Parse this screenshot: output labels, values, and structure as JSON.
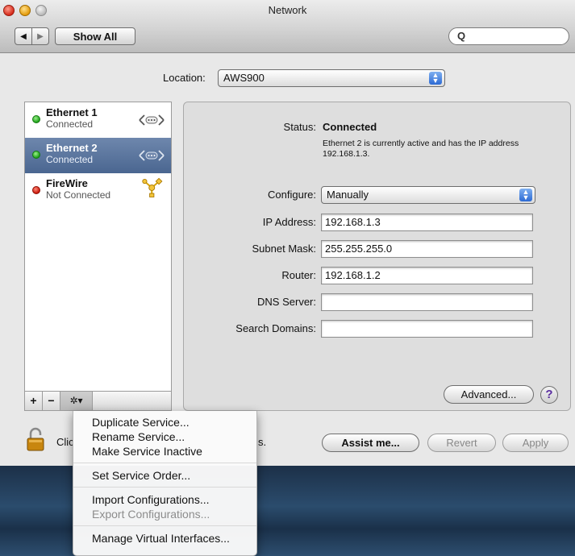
{
  "window": {
    "title": "Network",
    "show_all_label": "Show All",
    "back_glyph": "◀",
    "forward_glyph": "▶",
    "search_placeholder": "",
    "search_glyph": "Q"
  },
  "location": {
    "label": "Location:",
    "value": "AWS900"
  },
  "services": [
    {
      "name": "Ethernet 1",
      "status": "Connected",
      "status_color": "green",
      "icon": "ethernet-icon",
      "selected": false
    },
    {
      "name": "Ethernet 2",
      "status": "Connected",
      "status_color": "green",
      "icon": "ethernet-icon",
      "selected": true
    },
    {
      "name": "FireWire",
      "status": "Not Connected",
      "status_color": "red",
      "icon": "firewire-icon",
      "selected": false
    }
  ],
  "list_toolbar": {
    "add": "+",
    "remove": "−",
    "gear": "✲▾"
  },
  "detail": {
    "status_label": "Status:",
    "status_value": "Connected",
    "status_description": "Ethernet 2 is currently active and has the IP address 192.168.1.3.",
    "configure_label": "Configure:",
    "configure_value": "Manually",
    "ip_label": "IP Address:",
    "ip_value": "192.168.1.3",
    "subnet_label": "Subnet Mask:",
    "subnet_value": "255.255.255.0",
    "router_label": "Router:",
    "router_value": "192.168.1.2",
    "dns_label": "DNS Server:",
    "dns_value": "",
    "search_domains_label": "Search Domains:",
    "search_domains_value": "",
    "advanced_label": "Advanced...",
    "help_glyph": "?"
  },
  "footer": {
    "lock_text": "Clic",
    "lock_text_tail": "s.",
    "assist_label": "Assist me...",
    "revert_label": "Revert",
    "apply_label": "Apply"
  },
  "gear_menu": {
    "items": [
      {
        "label": "Duplicate Service...",
        "enabled": true
      },
      {
        "label": "Rename Service...",
        "enabled": true
      },
      {
        "label": "Make Service Inactive",
        "enabled": true
      },
      {
        "label": "Set Service Order...",
        "enabled": true
      },
      {
        "label": "Import Configurations...",
        "enabled": true
      },
      {
        "label": "Export Configurations...",
        "enabled": false
      },
      {
        "label": "Manage Virtual Interfaces...",
        "enabled": true
      }
    ]
  },
  "colors": {
    "selection": "#4a6690",
    "connected": "#1fa11a",
    "not_connected": "#c9170a"
  }
}
